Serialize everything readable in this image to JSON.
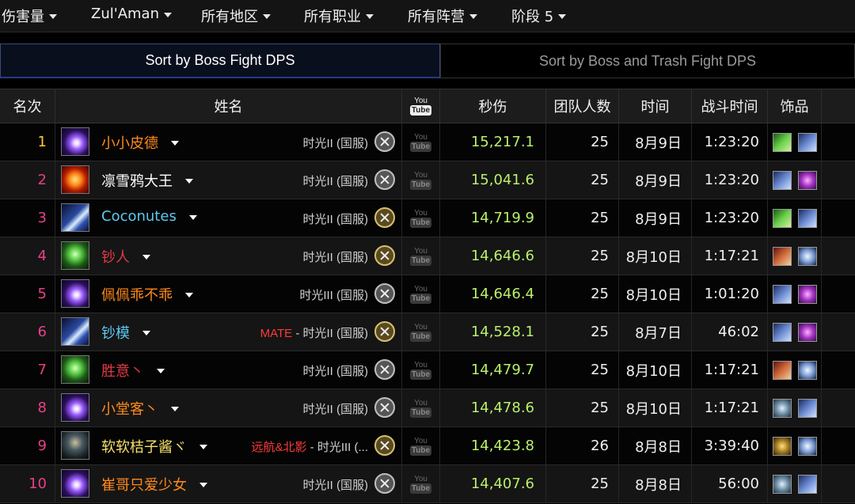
{
  "filters": [
    {
      "label": "伤害量"
    },
    {
      "label": "Zul'Aman"
    },
    {
      "label": "所有地区"
    },
    {
      "label": "所有职业"
    },
    {
      "label": "所有阵营"
    },
    {
      "label": "阶段 5"
    }
  ],
  "sort_tabs": {
    "active": "Sort by Boss Fight DPS",
    "inactive": "Sort by Boss and Trash Fight DPS"
  },
  "headers": {
    "rank": "名次",
    "name": "姓名",
    "youtube_top": "You",
    "youtube_bottom": "Tube",
    "dps": "秒伤",
    "raid_size": "团队人数",
    "date": "时间",
    "duration": "战斗时间",
    "trinkets": "饰品"
  },
  "rows": [
    {
      "rank": "1",
      "name": "小小皮德",
      "guild": "",
      "server": "时光II (国服)",
      "dps": "15,217.1",
      "size": "25",
      "date": "8月9日",
      "duration": "1:23:20",
      "name_color": "#ff8a1c",
      "spec_icon": "arcane-icon",
      "trinkets": [
        "green-trinket-icon",
        "blue-trinket-icon"
      ]
    },
    {
      "rank": "2",
      "name": "凛雪鸦大王",
      "guild": "",
      "server": "时光II (国服)",
      "dps": "15,041.6",
      "size": "25",
      "date": "8月9日",
      "duration": "1:23:20",
      "name_color": "#ffffff",
      "spec_icon": "destruction-icon",
      "trinkets": [
        "blue-trinket-icon",
        "purple-trinket-icon"
      ]
    },
    {
      "rank": "3",
      "name": "Coconutes",
      "guild": "",
      "server": "时光II (国服)",
      "dps": "14,719.9",
      "size": "25",
      "date": "8月9日",
      "duration": "1:23:20",
      "name_color": "#5cc8f0",
      "spec_icon": "frost-icon",
      "trinkets": [
        "green-trinket-icon",
        "blue-trinket-icon"
      ]
    },
    {
      "rank": "4",
      "name": "钞人",
      "guild": "",
      "server": "时光II (国服)",
      "dps": "14,646.6",
      "size": "25",
      "date": "8月10日",
      "duration": "1:17:21",
      "name_color": "#e03a44",
      "spec_icon": "affliction-icon",
      "trinkets": [
        "red-trinket-icon",
        "skull-trinket-icon"
      ]
    },
    {
      "rank": "5",
      "name": "佩佩乖不乖",
      "guild": "",
      "server": "时光III (国服)",
      "dps": "14,646.4",
      "size": "25",
      "date": "8月10日",
      "duration": "1:01:20",
      "name_color": "#ff8a1c",
      "spec_icon": "arcane-icon",
      "trinkets": [
        "blue-trinket-icon",
        "purple-trinket-icon"
      ]
    },
    {
      "rank": "6",
      "name": "钞模",
      "guild": "MATE",
      "server": " - 时光II (国服)",
      "dps": "14,528.1",
      "size": "25",
      "date": "8月7日",
      "duration": "46:02",
      "name_color": "#5cc8f0",
      "spec_icon": "frost-icon",
      "trinkets": [
        "blue-trinket-icon",
        "purple-trinket-icon"
      ]
    },
    {
      "rank": "7",
      "name": "胜意丶",
      "guild": "",
      "server": "时光II (国服)",
      "dps": "14,479.7",
      "size": "25",
      "date": "8月10日",
      "duration": "1:17:21",
      "name_color": "#e03a44",
      "spec_icon": "affliction-icon",
      "trinkets": [
        "red-trinket-icon",
        "skull-trinket-icon"
      ]
    },
    {
      "rank": "8",
      "name": "小堂客丶",
      "guild": "",
      "server": "时光II (国服)",
      "dps": "14,478.6",
      "size": "25",
      "date": "8月10日",
      "duration": "1:17:21",
      "name_color": "#ff8a1c",
      "spec_icon": "arcane-icon",
      "trinkets": [
        "grey-trinket-icon",
        "blue-trinket-icon"
      ]
    },
    {
      "rank": "9",
      "name": "软软桔子酱ヾ",
      "guild": "远航&北影",
      "server": " - 时光III (...",
      "dps": "14,423.8",
      "size": "26",
      "date": "8月8日",
      "duration": "3:39:40",
      "name_color": "#f5e06a",
      "spec_icon": "rogue-icon",
      "trinkets": [
        "gold-trinket-icon",
        "skull-trinket-icon"
      ]
    },
    {
      "rank": "10",
      "name": "崔哥只爱少女",
      "guild": "",
      "server": "时光II (国服)",
      "dps": "14,407.6",
      "size": "25",
      "date": "8月8日",
      "duration": "56:00",
      "name_color": "#ff8a1c",
      "spec_icon": "arcane-icon",
      "trinkets": [
        "grey-trinket-icon",
        "blue-trinket-icon"
      ]
    }
  ]
}
